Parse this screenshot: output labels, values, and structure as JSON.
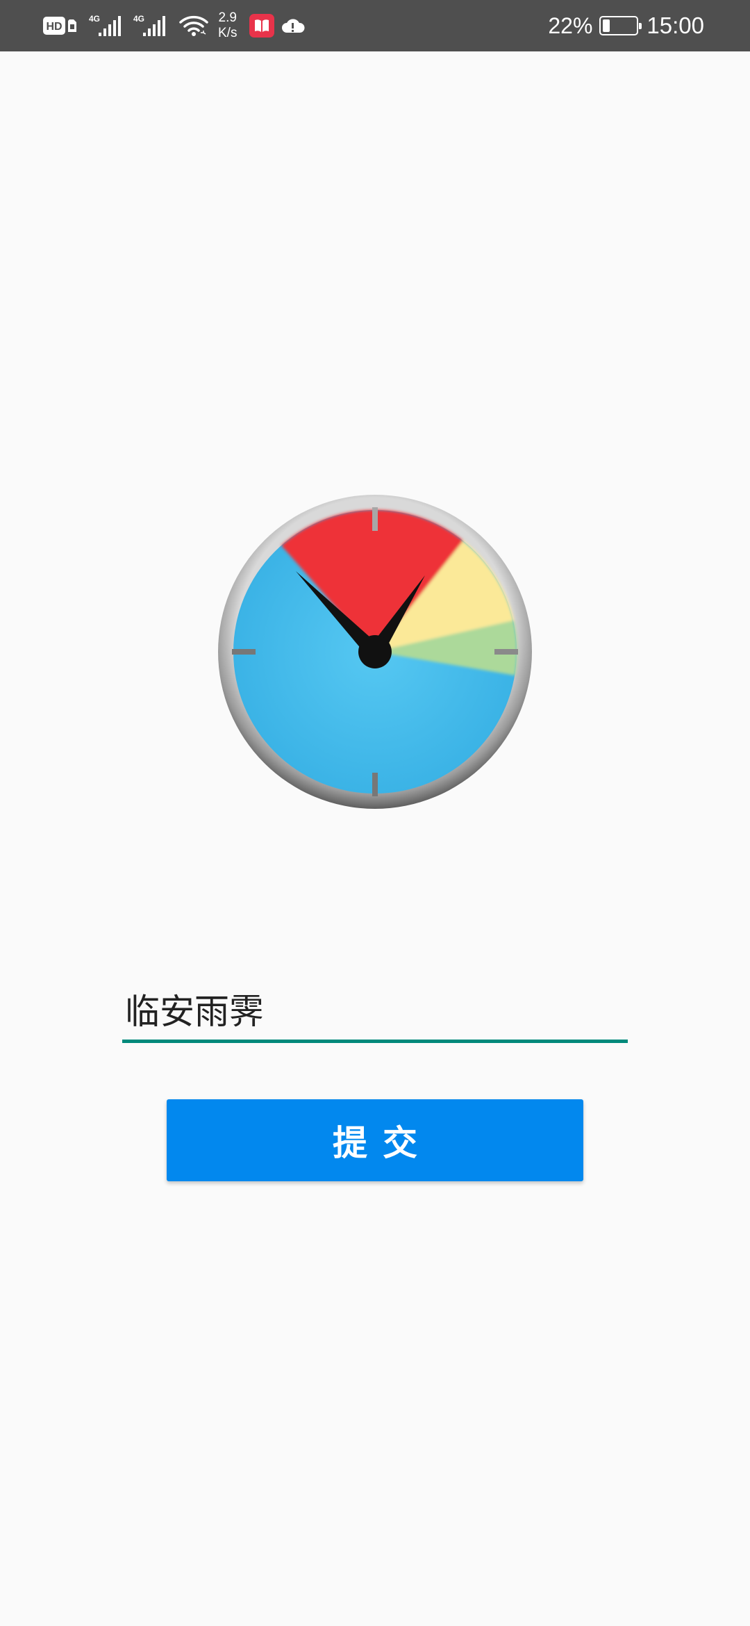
{
  "status_bar": {
    "hd_label": "HD",
    "network_1": "4G",
    "network_2": "4G",
    "speed_value": "2.9",
    "speed_unit": "K/s",
    "battery_percent": "22%",
    "battery_level": 0.22,
    "time": "15:00",
    "icons": [
      "hd-icon",
      "sim-card-icon",
      "signal-4g-icon",
      "signal-4g-icon",
      "wifi-icon",
      "book-app-icon",
      "cloud-alert-icon",
      "battery-icon"
    ]
  },
  "logo": {
    "icon": "pie-clock-logo-icon",
    "colors": {
      "blue": "#4ec3ef",
      "red": "#ee3339",
      "yellow": "#fbe998",
      "green": "#acd99a",
      "rim": "#8f8f8f",
      "hand": "#111111"
    }
  },
  "form": {
    "input_value": "临安雨霁",
    "submit_label": "提交"
  },
  "colors": {
    "status_bar_bg": "#4f4f4f",
    "page_bg": "#fafafa",
    "input_underline": "#00897b",
    "button_bg": "#0288ee",
    "button_text": "#ffffff"
  }
}
